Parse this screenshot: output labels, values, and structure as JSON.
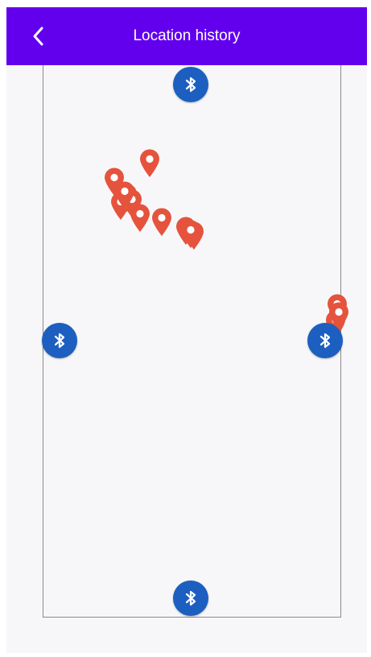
{
  "app_bar": {
    "title": "Location history",
    "back_icon": "chevron-left-icon",
    "color": "#6200ee"
  },
  "map": {
    "beacon_icon": "bluetooth-icon",
    "beacon_color": "#1c5fc0",
    "pin_icon": "location-pin-icon",
    "pin_color": "#e5533d",
    "beacon_count": 4,
    "pin_count": 14
  }
}
